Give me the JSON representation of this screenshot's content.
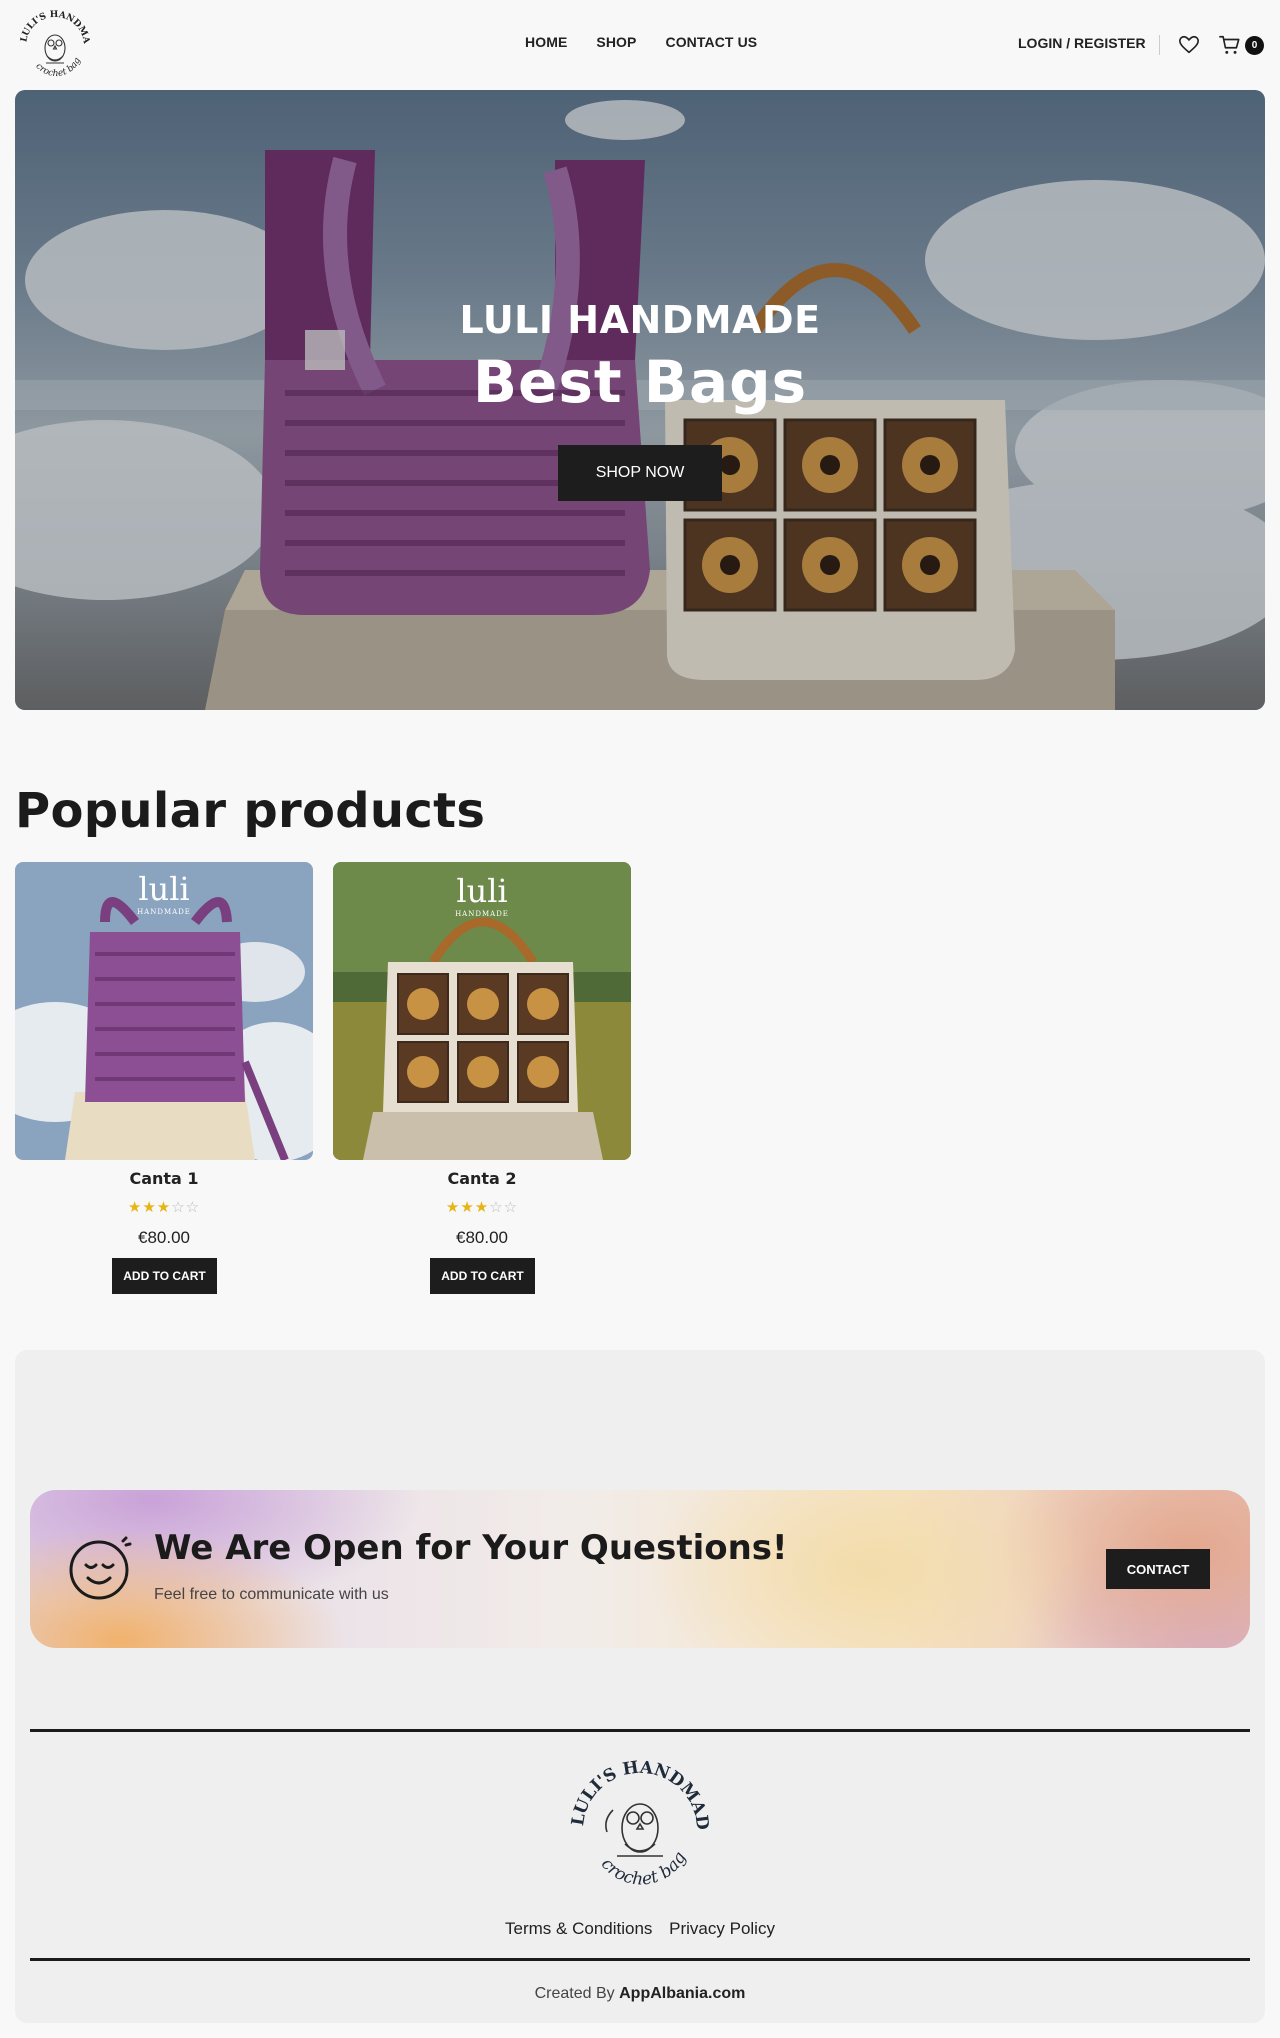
{
  "header": {
    "logo_alt": "Luli's Handmade crochet bag",
    "logo_text_top": "LULI'S HANDMADE",
    "logo_text_bottom": "crochet bag",
    "nav": [
      {
        "label": "HOME"
      },
      {
        "label": "SHOP"
      },
      {
        "label": "CONTACT US"
      }
    ],
    "account_label": "LOGIN / REGISTER",
    "wishlist_icon": "heart-icon",
    "cart_icon": "cart-icon",
    "cart_count": "0"
  },
  "hero": {
    "subtitle": "LULI HANDMADE",
    "title": "Best Bags",
    "button_label": "SHOP NOW"
  },
  "popular": {
    "title": "Popular products",
    "products": [
      {
        "name": "Canta 1",
        "rating": 2.5,
        "rating_max": 5,
        "price": "€80.00",
        "button": "ADD TO CART",
        "image_text": "luli",
        "image_subtext": "HANDMADE"
      },
      {
        "name": "Canta 2",
        "rating": 2.5,
        "rating_max": 5,
        "price": "€80.00",
        "button": "ADD TO CART",
        "image_text": "luli",
        "image_subtext": "HANDMADE"
      }
    ]
  },
  "contact_banner": {
    "icon": "smile-icon",
    "title": "We Are Open for Your Questions!",
    "subtitle": "Feel free to communicate with us",
    "button_label": "CONTACT"
  },
  "footer": {
    "logo_text_top": "LULI'S HANDMADE",
    "logo_text_bottom": "crochet bag",
    "links": [
      {
        "label": "Terms & Conditions"
      },
      {
        "label": "Privacy Policy"
      }
    ],
    "credits_prefix": "Created By",
    "credits_brand": "AppAlbania.com"
  },
  "colors": {
    "accent_dark": "#1d1d1d",
    "star": "#e7b416",
    "purple_bag": "#7a3f7e"
  }
}
